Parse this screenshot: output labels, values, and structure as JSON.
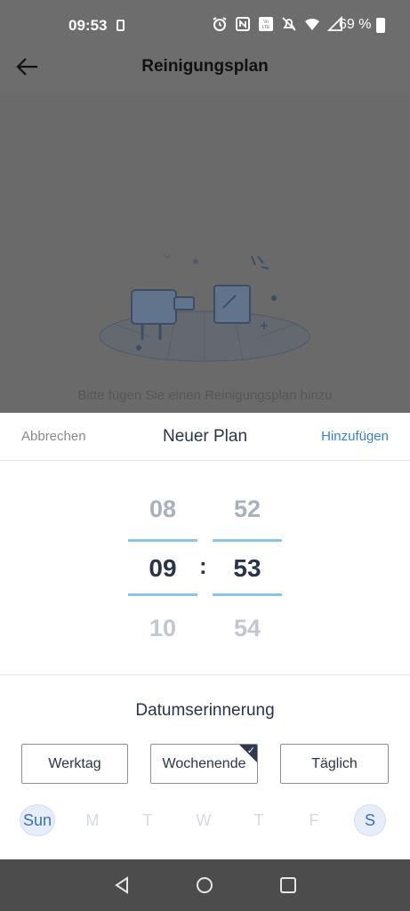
{
  "status_bar": {
    "time": "09:53",
    "battery_pct": "69 %",
    "icons": [
      "sim-icon",
      "alarm-icon",
      "nfc-icon",
      "volte-icon",
      "mute-icon",
      "wifi-icon",
      "signal-icon",
      "battery-icon"
    ]
  },
  "header": {
    "title": "Reinigungsplan"
  },
  "empty_state": {
    "message": "Bitte fügen Sie einen Reinigungsplan hinzu"
  },
  "sheet": {
    "cancel_label": "Abbrechen",
    "title": "Neuer Plan",
    "add_label": "Hinzufügen",
    "hours": {
      "prev": "08",
      "current": "09",
      "next": "10"
    },
    "minutes": {
      "prev": "52",
      "current": "53",
      "next": "54"
    },
    "separator": ":",
    "reminder_title": "Datumserinnerung",
    "options": [
      {
        "label": "Werktag",
        "selected": false
      },
      {
        "label": "Wochenende",
        "selected": true
      },
      {
        "label": "Täglich",
        "selected": false
      }
    ],
    "days": [
      {
        "label": "Sun",
        "selected": true
      },
      {
        "label": "M",
        "selected": false
      },
      {
        "label": "T",
        "selected": false
      },
      {
        "label": "W",
        "selected": false
      },
      {
        "label": "T",
        "selected": false
      },
      {
        "label": "F",
        "selected": false
      },
      {
        "label": "S",
        "selected": true
      }
    ]
  },
  "colors": {
    "accent": "#3a7fd0",
    "picker_line": "#8ec4e6",
    "text_dark": "#2a3448",
    "overlay": "#6e6e6e"
  }
}
